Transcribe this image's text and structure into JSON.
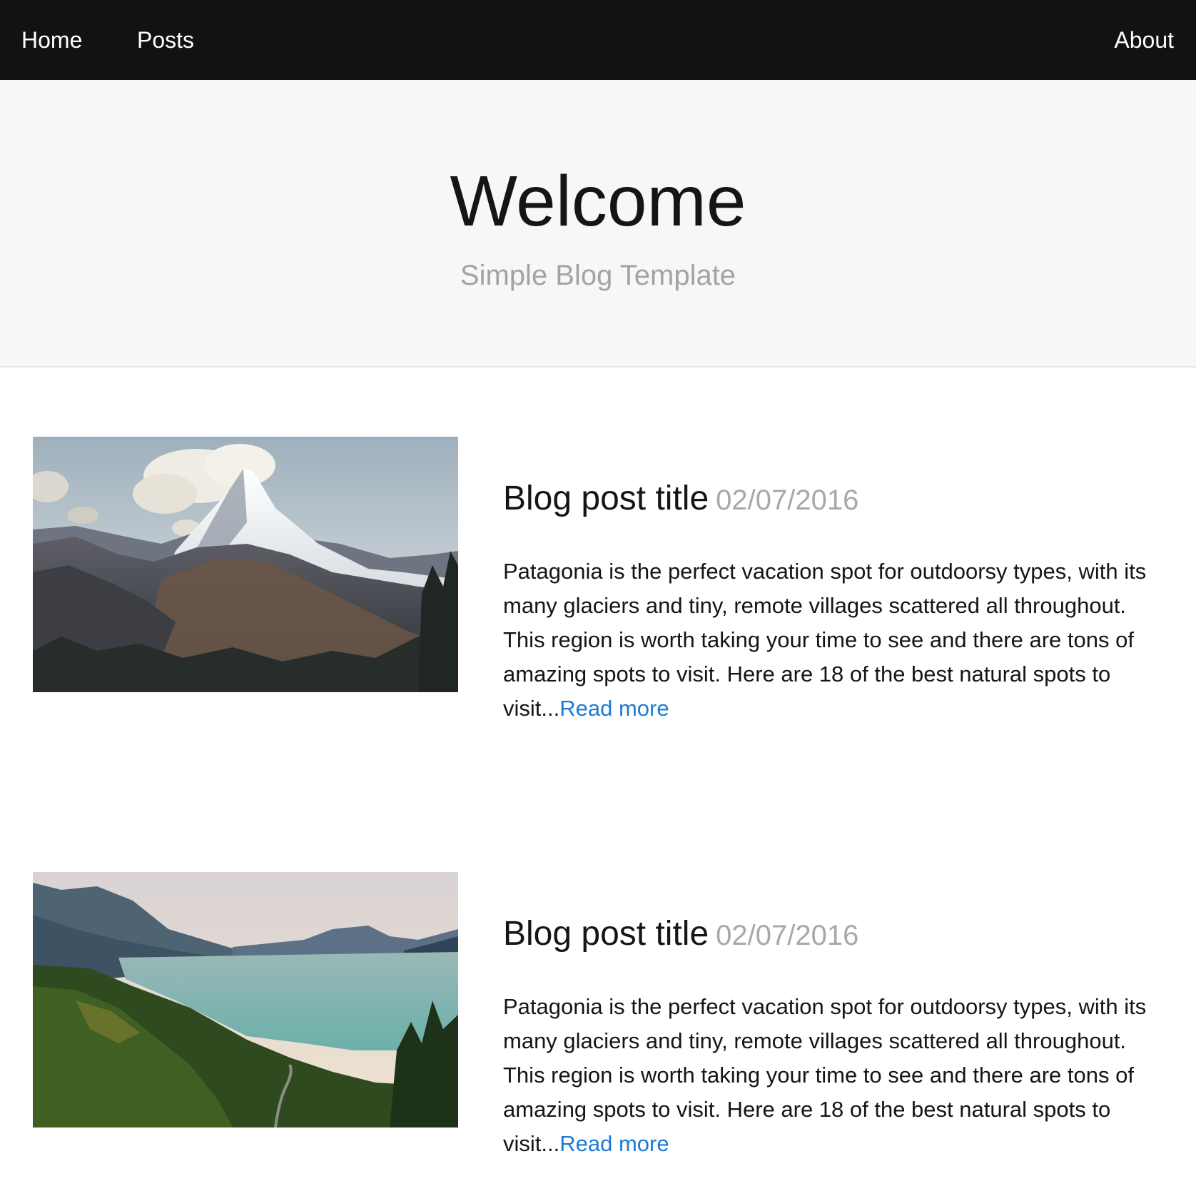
{
  "nav": {
    "home": "Home",
    "posts": "Posts",
    "about": "About"
  },
  "hero": {
    "title": "Welcome",
    "subtitle": "Simple Blog Template"
  },
  "posts": [
    {
      "title": "Blog post title",
      "date": "02/07/2016",
      "excerpt": "Patagonia is the perfect vacation spot for outdoorsy types, with its many glaciers and tiny, remote villages scattered all throughout. This region is worth taking your time to see and there are tons of amazing spots to visit. Here are 18 of the best natural spots to visit...",
      "read_more": "Read more",
      "image": "mountain-peak-photo"
    },
    {
      "title": "Blog post title",
      "date": "02/07/2016",
      "excerpt": "Patagonia is the perfect vacation spot for outdoorsy types, with its many glaciers and tiny, remote villages scattered all throughout. This region is worth taking your time to see and there are tons of amazing spots to visit. Here are 18 of the best natural spots to visit...",
      "read_more": "Read more",
      "image": "lake-forest-photo"
    }
  ],
  "colors": {
    "nav_bg": "#121212",
    "hero_bg": "#f7f7f7",
    "link": "#1c7ad6",
    "muted": "#a8a8a8"
  }
}
